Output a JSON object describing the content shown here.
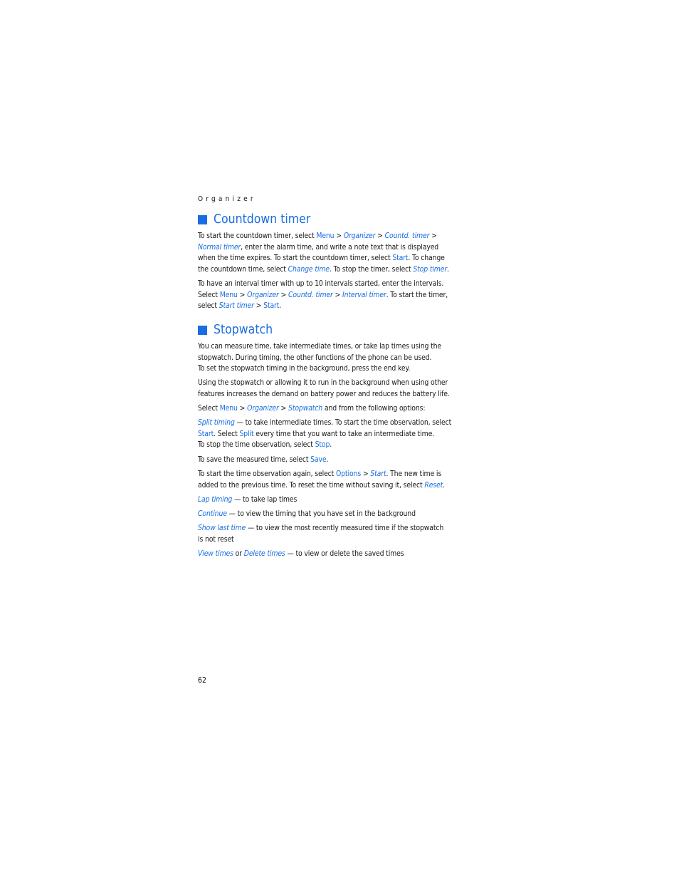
{
  "running_head": "Organizer",
  "page_number": "62",
  "sections": [
    {
      "title": "Countdown timer",
      "paragraphs": [
        [
          [
            {
              "t": "To start the countdown timer, select "
            },
            {
              "t": "Menu",
              "s": "b"
            },
            {
              "t": " > "
            },
            {
              "t": "Organizer",
              "s": "i"
            },
            {
              "t": " > "
            },
            {
              "t": "Countd. timer",
              "s": "i"
            },
            {
              "t": " >"
            }
          ],
          [
            {
              "t": "Normal timer",
              "s": "i"
            },
            {
              "t": ", enter the alarm time, and write a note text that is displayed"
            }
          ],
          [
            {
              "t": "when the time expires. To start the countdown timer, select "
            },
            {
              "t": "Start",
              "s": "b"
            },
            {
              "t": ". To change"
            }
          ],
          [
            {
              "t": "the countdown time, select "
            },
            {
              "t": "Change time",
              "s": "i"
            },
            {
              "t": ". To stop the timer, select "
            },
            {
              "t": "Stop timer",
              "s": "i"
            },
            {
              "t": "."
            }
          ]
        ],
        [
          [
            {
              "t": "To have an interval timer with up to 10 intervals started, enter the intervals."
            }
          ],
          [
            {
              "t": "Select "
            },
            {
              "t": "Menu",
              "s": "b"
            },
            {
              "t": " > "
            },
            {
              "t": "Organizer",
              "s": "i"
            },
            {
              "t": " > "
            },
            {
              "t": "Countd. timer",
              "s": "i"
            },
            {
              "t": " > "
            },
            {
              "t": "Interval timer",
              "s": "i"
            },
            {
              "t": ". To start the timer,"
            }
          ],
          [
            {
              "t": "select "
            },
            {
              "t": "Start timer",
              "s": "i"
            },
            {
              "t": " > "
            },
            {
              "t": "Start",
              "s": "b"
            },
            {
              "t": "."
            }
          ]
        ]
      ]
    },
    {
      "title": "Stopwatch",
      "paragraphs": [
        [
          [
            {
              "t": "You can measure time, take intermediate times, or take lap times using the"
            }
          ],
          [
            {
              "t": "stopwatch. During timing, the other functions of the phone can be used."
            }
          ],
          [
            {
              "t": "To set the stopwatch timing in the background, press the end key."
            }
          ]
        ],
        [
          [
            {
              "t": "Using the stopwatch or allowing it to run in the background when using other"
            }
          ],
          [
            {
              "t": "features increases the demand on battery power and reduces the battery life."
            }
          ]
        ],
        [
          [
            {
              "t": "Select "
            },
            {
              "t": "Menu",
              "s": "b"
            },
            {
              "t": " > "
            },
            {
              "t": "Organizer",
              "s": "i"
            },
            {
              "t": " > "
            },
            {
              "t": "Stopwatch",
              "s": "i"
            },
            {
              "t": " and from the following options:"
            }
          ]
        ],
        [
          [
            {
              "t": "Split timing",
              "s": "i"
            },
            {
              "t": " — to take intermediate times. To start the time observation, select"
            }
          ],
          [
            {
              "t": "Start",
              "s": "b"
            },
            {
              "t": ". Select "
            },
            {
              "t": "Split",
              "s": "b"
            },
            {
              "t": " every time that you want to take an intermediate time."
            }
          ],
          [
            {
              "t": "To stop the time observation, select "
            },
            {
              "t": "Stop",
              "s": "b"
            },
            {
              "t": "."
            }
          ]
        ],
        [
          [
            {
              "t": "To save the measured time, select "
            },
            {
              "t": "Save",
              "s": "b"
            },
            {
              "t": "."
            }
          ]
        ],
        [
          [
            {
              "t": "To start the time observation again, select "
            },
            {
              "t": "Options",
              "s": "b"
            },
            {
              "t": " > "
            },
            {
              "t": "Start",
              "s": "i"
            },
            {
              "t": ". The new time is"
            }
          ],
          [
            {
              "t": "added to the previous time. To reset the time without saving it, select "
            },
            {
              "t": "Reset",
              "s": "i"
            },
            {
              "t": "."
            }
          ]
        ],
        [
          [
            {
              "t": "Lap timing",
              "s": "i"
            },
            {
              "t": " — to take lap times"
            }
          ]
        ],
        [
          [
            {
              "t": "Continue",
              "s": "i"
            },
            {
              "t": " — to view the timing that you have set in the background"
            }
          ]
        ],
        [
          [
            {
              "t": "Show last time",
              "s": "i"
            },
            {
              "t": " — to view the most recently measured time if the stopwatch"
            }
          ],
          [
            {
              "t": "is not reset"
            }
          ]
        ],
        [
          [
            {
              "t": "View times",
              "s": "i"
            },
            {
              "t": " or "
            },
            {
              "t": "Delete times",
              "s": "i"
            },
            {
              "t": " — to view or delete the saved times"
            }
          ]
        ]
      ]
    }
  ]
}
